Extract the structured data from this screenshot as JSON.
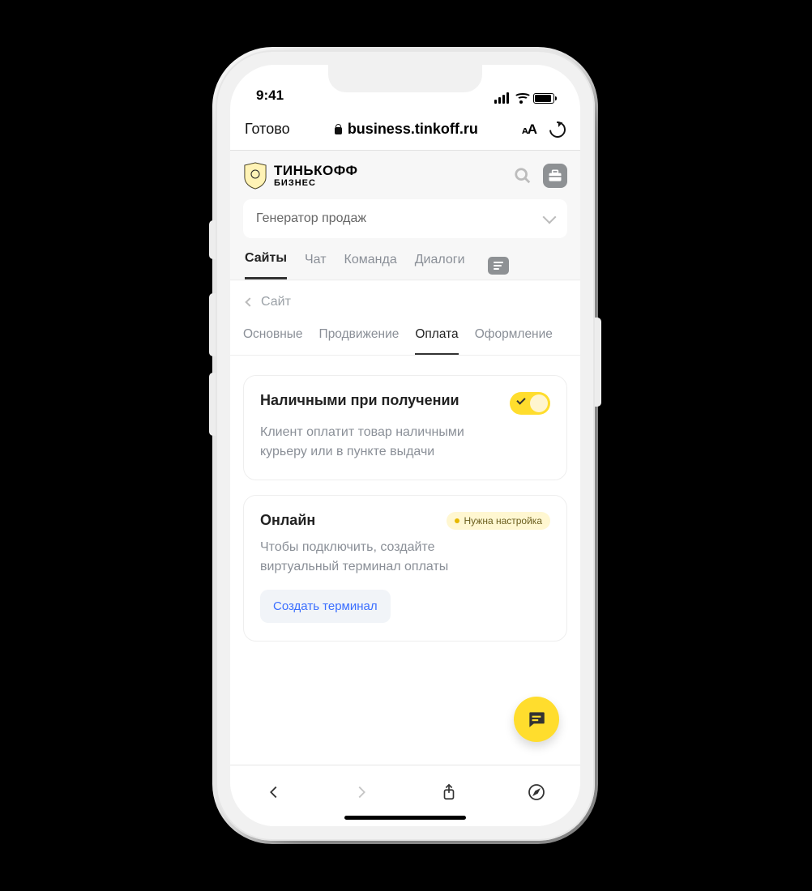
{
  "status": {
    "time": "9:41"
  },
  "safari": {
    "done": "Готово",
    "url": "business.tinkoff.ru"
  },
  "header": {
    "brand_line1": "ТИНЬКОФФ",
    "brand_line2": "БИЗНЕС"
  },
  "section_dropdown": {
    "value": "Генератор продаж"
  },
  "main_tabs": [
    {
      "label": "Сайты",
      "active": true
    },
    {
      "label": "Чат",
      "active": false
    },
    {
      "label": "Команда",
      "active": false
    },
    {
      "label": "Диалоги",
      "active": false
    }
  ],
  "breadcrumb": {
    "back_label": "Сайт"
  },
  "sub_tabs": [
    {
      "label": "Основные",
      "active": false
    },
    {
      "label": "Продвижение",
      "active": false
    },
    {
      "label": "Оплата",
      "active": true
    },
    {
      "label": "Оформление",
      "active": false
    }
  ],
  "cards": {
    "cash": {
      "title": "Наличными при получении",
      "desc": "Клиент оплатит товар наличными курьеру или в пункте выдачи",
      "enabled": true
    },
    "online": {
      "title": "Онлайн",
      "badge": "Нужна настройка",
      "desc": "Чтобы подключить, создайте виртуальный терминал оплаты",
      "button": "Создать терминал"
    }
  }
}
